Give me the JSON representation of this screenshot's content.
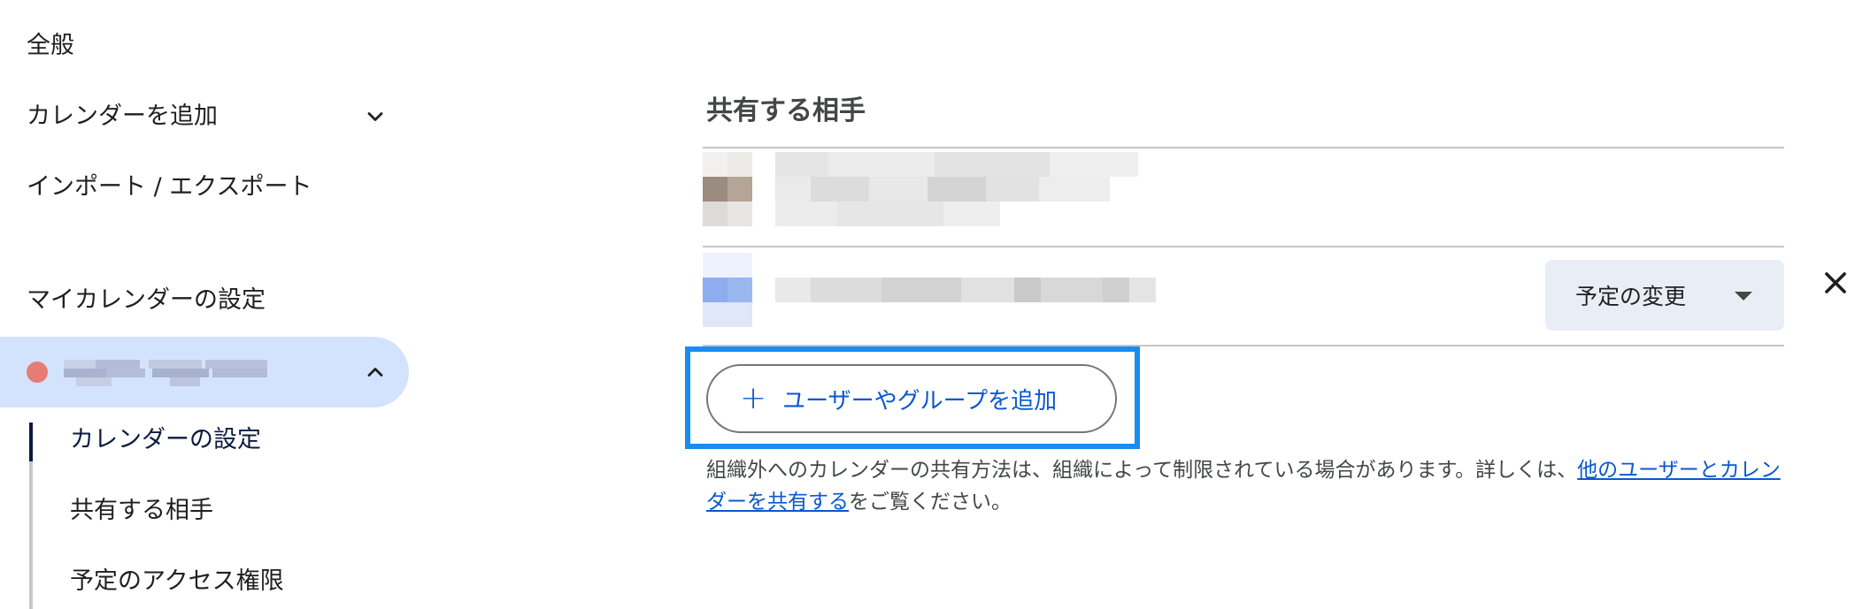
{
  "sidebar": {
    "general": "全般",
    "add_calendar": "カレンダーを追加",
    "import_export": "インポート / エクスポート",
    "my_calendars_heading": "マイカレンダーの設定",
    "selected_calendar": {
      "name": "",
      "color": "#e67c73"
    },
    "sub_items": [
      {
        "label": "カレンダーの設定"
      },
      {
        "label": "共有する相手"
      },
      {
        "label": "予定のアクセス権限"
      }
    ]
  },
  "main": {
    "section_title": "共有する相手",
    "share_rows": [
      {
        "name": "",
        "permission": ""
      },
      {
        "name": "",
        "permission": "予定の変更"
      }
    ],
    "add_button": "ユーザーやグループを追加",
    "note_prefix": "組織外へのカレンダーの共有方法は、組織によって制限されている場合があります。詳しくは、",
    "note_link": "他のユーザーとカレンダーを共有する",
    "note_suffix": "をご覧ください。"
  },
  "colors": {
    "selected_bg": "#d3e3fd",
    "accent_blue": "#0b57d0",
    "highlight_box": "#1a8cf0",
    "calendar_dot": "#e67c73"
  },
  "icons": {
    "add_calendar_expand": "chevron-down-icon",
    "calendar_collapse": "chevron-up-icon",
    "permission_dropdown": "caret-down-icon",
    "remove_share": "close-icon",
    "add_user": "plus-icon"
  }
}
